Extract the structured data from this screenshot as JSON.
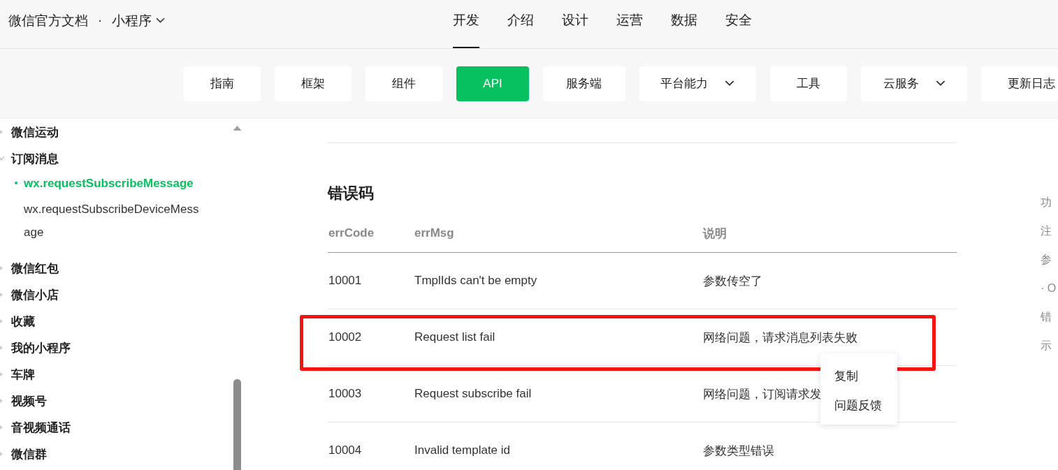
{
  "header": {
    "site_title": "微信官方文档",
    "separator": "·",
    "product": "小程序"
  },
  "nav_tabs": [
    {
      "label": "开发",
      "selected": true
    },
    {
      "label": "介绍",
      "selected": false
    },
    {
      "label": "设计",
      "selected": false
    },
    {
      "label": "运营",
      "selected": false
    },
    {
      "label": "数据",
      "selected": false
    },
    {
      "label": "安全",
      "selected": false
    }
  ],
  "sub_nav": [
    {
      "label": "指南",
      "selected": false,
      "dropdown": false
    },
    {
      "label": "框架",
      "selected": false,
      "dropdown": false
    },
    {
      "label": "组件",
      "selected": false,
      "dropdown": false
    },
    {
      "label": "API",
      "selected": true,
      "dropdown": false
    },
    {
      "label": "服务端",
      "selected": false,
      "dropdown": false
    },
    {
      "label": "平台能力",
      "selected": false,
      "dropdown": true
    },
    {
      "label": "工具",
      "selected": false,
      "dropdown": false
    },
    {
      "label": "云服务",
      "selected": false,
      "dropdown": true
    },
    {
      "label": "更新日志",
      "selected": false,
      "dropdown": false
    }
  ],
  "sidebar": {
    "items": [
      {
        "label": "微信运动",
        "expanded": false
      },
      {
        "label": "订阅消息",
        "expanded": true,
        "children": [
          {
            "label": "wx.requestSubscribeMessage",
            "selected": true
          },
          {
            "label": "wx.requestSubscribeDeviceMessage",
            "selected": false
          }
        ]
      },
      {
        "label": "微信红包",
        "expanded": false
      },
      {
        "label": "微信小店",
        "expanded": false
      },
      {
        "label": "收藏",
        "expanded": false
      },
      {
        "label": "我的小程序",
        "expanded": false
      },
      {
        "label": "车牌",
        "expanded": false
      },
      {
        "label": "视频号",
        "expanded": false
      },
      {
        "label": "音视频通话",
        "expanded": false
      },
      {
        "label": "微信群",
        "expanded": false
      }
    ]
  },
  "content": {
    "heading": "错误码",
    "table": {
      "columns": [
        "errCode",
        "errMsg",
        "说明"
      ],
      "rows": [
        [
          "10001",
          "TmplIds can't be empty",
          "参数传空了"
        ],
        [
          "10002",
          "Request list fail",
          "网络问题，请求消息列表失败"
        ],
        [
          "10003",
          "Request subscribe fail",
          "网络问题，订阅请求发"
        ],
        [
          "10004",
          "Invalid template id",
          "参数类型错误"
        ]
      ]
    }
  },
  "context_menu": {
    "items": [
      "复制",
      "问题反馈"
    ]
  },
  "toc": {
    "items": [
      "功",
      "注",
      "参",
      "· O",
      "错",
      "示"
    ]
  }
}
